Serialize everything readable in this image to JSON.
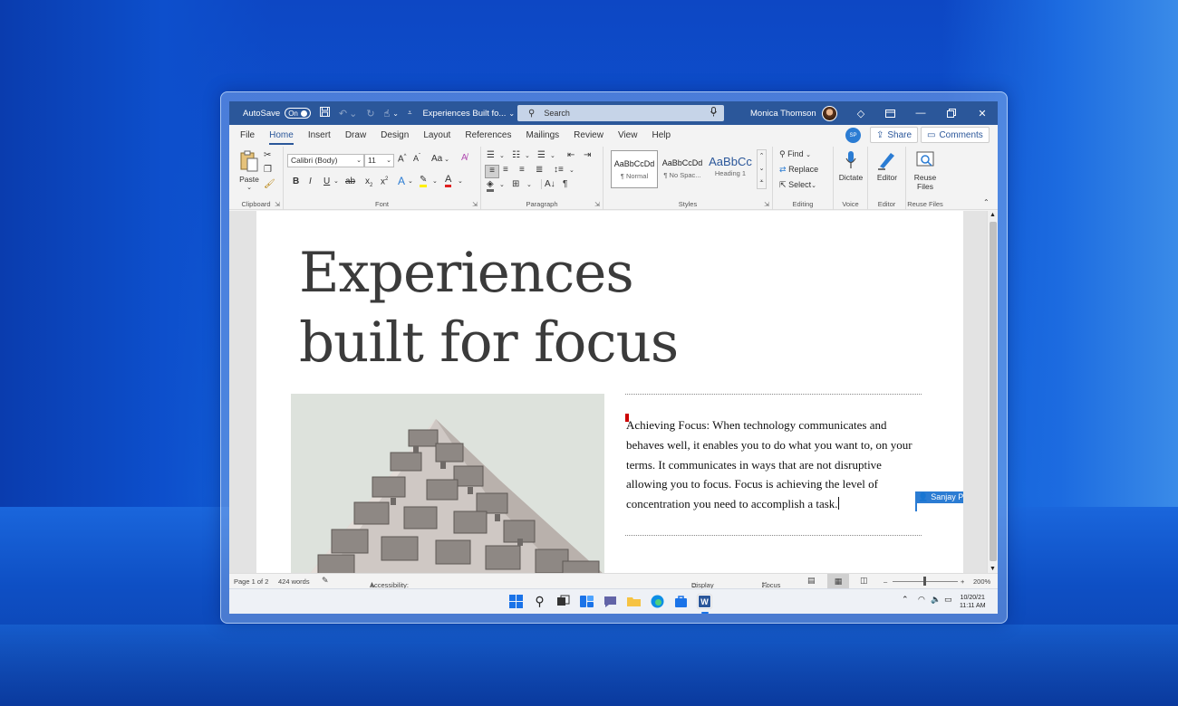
{
  "window": {
    "autosave_label": "AutoSave",
    "autosave_state": "On",
    "doc_title": "Experiences Built fo...",
    "doc_title_caret": "⌄",
    "search_placeholder": "Search",
    "user_name": "Monica Thomson"
  },
  "tabs": [
    "File",
    "Home",
    "Insert",
    "Draw",
    "Design",
    "Layout",
    "References",
    "Mailings",
    "Review",
    "View",
    "Help"
  ],
  "collab_initials": "SP",
  "share_label": "Share",
  "comments_label": "Comments",
  "ribbon": {
    "clipboard": {
      "label": "Clipboard",
      "paste": "Paste"
    },
    "font": {
      "label": "Font",
      "font_name": "Calibri (Body)",
      "font_size": "11",
      "aa_label": "Aa"
    },
    "paragraph": {
      "label": "Paragraph"
    },
    "styles": {
      "label": "Styles",
      "items": [
        {
          "sample": "AaBbCcDd",
          "name": "¶ Normal"
        },
        {
          "sample": "AaBbCcDd",
          "name": "¶ No Spac..."
        },
        {
          "sample": "AaBbCc",
          "name": "Heading 1"
        }
      ]
    },
    "editing": {
      "label": "Editing",
      "find": "Find",
      "replace": "Replace",
      "select": "Select"
    },
    "voice": {
      "label": "Voice",
      "dictate": "Dictate"
    },
    "editor": {
      "label": "Editor",
      "editor": "Editor"
    },
    "reuse": {
      "label": "Reuse Files",
      "reuse": "Reuse",
      "files": "Files"
    }
  },
  "document": {
    "heading_line1": "Experiences",
    "heading_line2": "built for focus",
    "paragraph": "Achieving Focus: When technology communicates and behaves well, it enables you to do what you want to, on your terms. It communicates in ways that are not disruptive allowing you to focus. Focus is achieving the level of concentration you need to accomplish a task.",
    "collaborator": "Sanjay Puranik"
  },
  "status": {
    "page": "Page 1 of 2",
    "words": "424 words",
    "accessibility": "Accessibility: Good to go",
    "display_settings": "Display Settings",
    "focus": "Focus",
    "zoom_minus": "–",
    "zoom_plus": "+",
    "zoom": "200%"
  },
  "taskbar": {
    "date": "10/20/21",
    "time": "11:11 AM"
  },
  "colors": {
    "accent": "#2b579a",
    "collab": "#2b7cd3"
  }
}
